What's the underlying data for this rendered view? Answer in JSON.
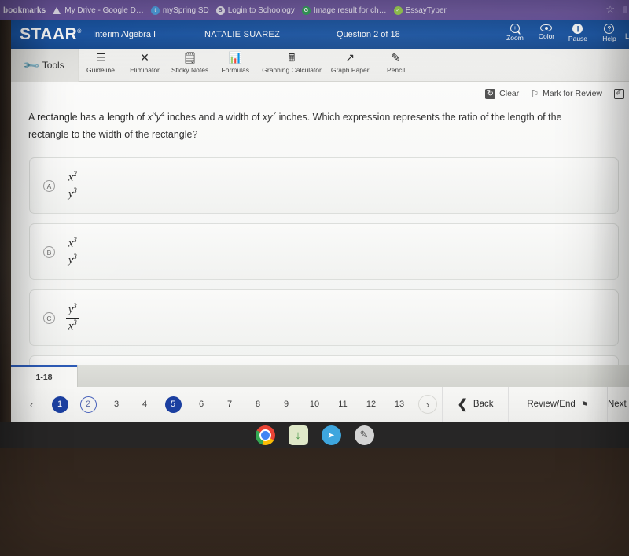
{
  "browser": {
    "bookmarks_label": "bookmarks",
    "bookmarks": [
      {
        "label": "My Drive - Google D…",
        "icon": "google-drive-icon"
      },
      {
        "label": "mySpringISD",
        "icon": "myspringisd-icon"
      },
      {
        "label": "Login to Schoology",
        "icon": "schoology-icon"
      },
      {
        "label": "Image result for ch…",
        "icon": "google-icon"
      },
      {
        "label": "EssayTyper",
        "icon": "essaytyper-icon"
      }
    ],
    "star_icon": "bookmark-star-icon"
  },
  "header": {
    "logo": "STAAR",
    "logo_mark": "®",
    "test_name": "Interim Algebra I",
    "student_name": "NATALIE SUAREZ",
    "question_counter": "Question 2 of 18",
    "accent_color": "#17519e",
    "tools": [
      {
        "label": "Zoom",
        "icon": "zoom-icon"
      },
      {
        "label": "Color",
        "icon": "color-eye-icon"
      },
      {
        "label": "Pause",
        "icon": "pause-icon"
      },
      {
        "label": "Help",
        "icon": "help-icon"
      }
    ],
    "edge_tool_label": "L"
  },
  "toolbar": {
    "tools_label": "Tools",
    "tools_icon": "wrench-icon",
    "items": [
      {
        "label": "Guideline",
        "icon": "guideline-icon",
        "glyph": "☰"
      },
      {
        "label": "Eliminator",
        "icon": "eliminator-icon",
        "glyph": "✕"
      },
      {
        "label": "Sticky Notes",
        "icon": "sticky-notes-icon",
        "glyph": "὜9"
      },
      {
        "label": "Formulas",
        "icon": "formulas-icon",
        "glyph": "ὌA"
      },
      {
        "label": "Graphing Calculator",
        "icon": "graphing-calculator-icon",
        "glyph": "὚9"
      },
      {
        "label": "Graph Paper",
        "icon": "graph-paper-icon",
        "glyph": "↗"
      },
      {
        "label": "Pencil",
        "icon": "pencil-icon",
        "glyph": "✎"
      }
    ]
  },
  "actions": {
    "clear_label": "Clear",
    "clear_icon": "undo-clear-icon",
    "mark_label": "Mark for Review",
    "mark_icon": "flag-outline-icon",
    "edit_icon": "edit-note-icon"
  },
  "question": {
    "part1": "A rectangle has a length of ",
    "expr1_base1": "x",
    "expr1_exp1": "3",
    "expr1_base2": "y",
    "expr1_exp2": "4",
    "part2": " inches and a width of ",
    "expr2_base1": "x",
    "expr2_base2": "y",
    "expr2_exp2": "7",
    "part3": " inches. Which expression represents the ratio of the length of the rectangle to the width of the rectangle?",
    "choices": [
      {
        "letter": "A",
        "num_base": "x",
        "num_exp": "2",
        "den_base": "y",
        "den_exp": "3"
      },
      {
        "letter": "B",
        "num_base": "x",
        "num_exp": "3",
        "den_base": "y",
        "den_exp": "3"
      },
      {
        "letter": "C",
        "num_base": "y",
        "num_exp": "3",
        "den_base": "x",
        "den_exp": "3"
      }
    ]
  },
  "pagination": {
    "range_tab": "1-18",
    "prev_arrow": "‹",
    "next_arrow": "›",
    "pages": [
      {
        "n": "1",
        "state": "filled"
      },
      {
        "n": "2",
        "state": "ring"
      },
      {
        "n": "3",
        "state": "plain"
      },
      {
        "n": "4",
        "state": "plain"
      },
      {
        "n": "5",
        "state": "filled"
      },
      {
        "n": "6",
        "state": "plain"
      },
      {
        "n": "7",
        "state": "plain"
      },
      {
        "n": "8",
        "state": "plain"
      },
      {
        "n": "9",
        "state": "plain"
      },
      {
        "n": "10",
        "state": "plain"
      },
      {
        "n": "11",
        "state": "plain"
      },
      {
        "n": "12",
        "state": "plain"
      },
      {
        "n": "13",
        "state": "plain"
      }
    ],
    "back_label": "Back",
    "review_label": "Review/End",
    "review_icon": "flag-filled-icon",
    "next_label": "Next",
    "active_page_color": "#1b3fa0"
  },
  "shelf": {
    "apps": [
      {
        "name": "chrome-icon"
      },
      {
        "name": "downloads-icon"
      },
      {
        "name": "assessment-icon"
      },
      {
        "name": "tools-app-icon"
      }
    ]
  }
}
